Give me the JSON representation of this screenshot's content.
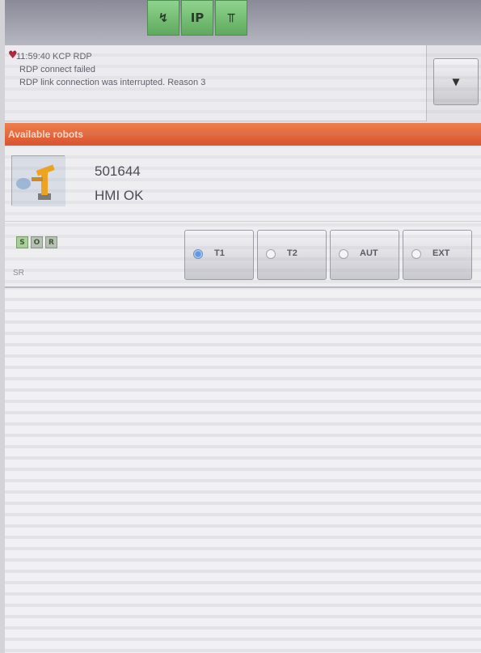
{
  "status_bar": {
    "icons": [
      {
        "name": "drive-icon",
        "glyph": "↯"
      },
      {
        "name": "ip-icon",
        "glyph": "IP"
      },
      {
        "name": "robot-arm-icon",
        "glyph": "⫪"
      }
    ],
    "icon_color": "#6cb96b"
  },
  "messages": {
    "icon": "heart-alert-icon",
    "line1": "11:59:40 KCP RDP",
    "line2": "RDP connect failed",
    "line3": "RDP link connection was interrupted. Reason 3",
    "scroll_icon": "chevron-down-double-icon"
  },
  "section": {
    "title": "Available robots",
    "color": "#e0623a"
  },
  "robot": {
    "name": "501644",
    "status": "HMI OK",
    "thumbnail_icon": "robot-arm-icon",
    "indicators": [
      {
        "label": "S",
        "icon": "s-indicator-icon"
      },
      {
        "label": "O",
        "icon": "o-indicator-icon"
      },
      {
        "label": "R",
        "icon": "r-indicator-icon"
      }
    ],
    "indicator_caption": "SR",
    "modes": [
      {
        "label": "T1",
        "selected": true
      },
      {
        "label": "T2",
        "selected": false
      },
      {
        "label": "AUT",
        "selected": false
      },
      {
        "label": "EXT",
        "selected": false
      }
    ]
  }
}
